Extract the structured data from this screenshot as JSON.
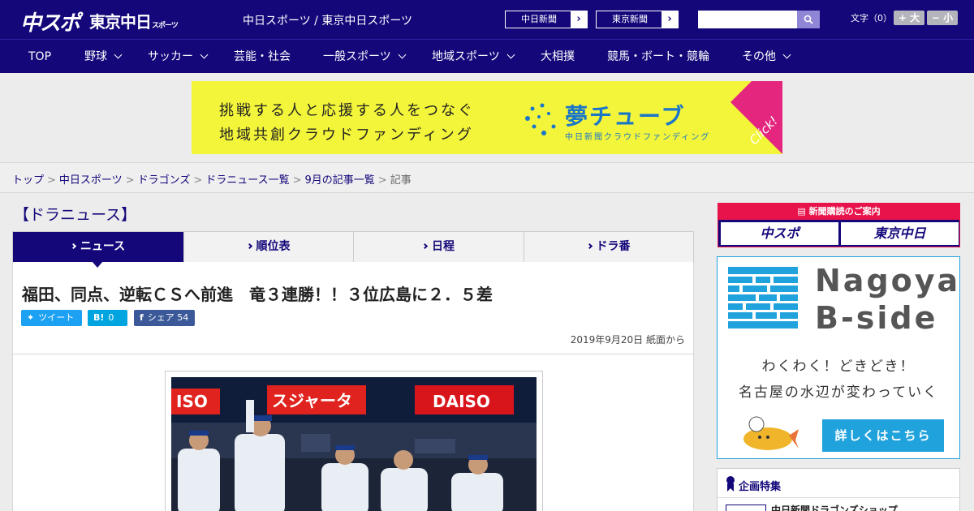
{
  "header": {
    "logo_main": "中スポ",
    "logo_tokyo": "東京中日",
    "logo_tokyo_small": "スポーツ",
    "site_title": "中日スポーツ / 東京中日スポーツ",
    "links": [
      "中日新聞",
      "東京新聞"
    ],
    "search_placeholder": "",
    "font_label": "文字（0）",
    "font_larger": "+ 大",
    "font_smaller": "− 小"
  },
  "nav": {
    "items": [
      {
        "label": "TOP",
        "dropdown": false
      },
      {
        "label": "野球",
        "dropdown": true
      },
      {
        "label": "サッカー",
        "dropdown": true
      },
      {
        "label": "芸能・社会",
        "dropdown": false
      },
      {
        "label": "一般スポーツ",
        "dropdown": true
      },
      {
        "label": "地域スポーツ",
        "dropdown": true
      },
      {
        "label": "大相撲",
        "dropdown": false
      },
      {
        "label": "競馬・ボート・競輪",
        "dropdown": false
      },
      {
        "label": "その他",
        "dropdown": true
      }
    ]
  },
  "banner": {
    "line1": "挑戦する人と応援する人をつなぐ",
    "line2": "地域共創クラウドファンディング",
    "brand": "夢チューブ",
    "brand_sub": "中日新聞クラウドファンディング",
    "click": "Click!"
  },
  "breadcrumb": {
    "links": [
      "トップ",
      "中日スポーツ",
      "ドラゴンズ",
      "ドラニュース一覧",
      "9月の記事一覧"
    ],
    "current": "記事"
  },
  "main": {
    "section_title": "【ドラニュース】",
    "tabs": [
      {
        "label": "ニュース",
        "active": true
      },
      {
        "label": "順位表",
        "active": false
      },
      {
        "label": "日程",
        "active": false
      },
      {
        "label": "ドラ番",
        "active": false
      }
    ],
    "headline": "福田、同点、逆転ＣＳへ前進　竜３連勝！！３位広島に２．５差",
    "share": {
      "tweet": "ツイート",
      "hatena": "0",
      "facebook": "シェア 54"
    },
    "date": "2019年9月20日 紙面から",
    "photo_signs": [
      "ISO",
      "スジャータ",
      "DAISO"
    ]
  },
  "sidebar": {
    "subscribe_title": "新聞購読のご案内",
    "subscribe_buttons": [
      "中スポ",
      "東京中日"
    ],
    "ad": {
      "title_line1": "Nagoya",
      "title_line2": "B-side",
      "text1": "わくわく！どきどき！",
      "text2": "名古屋の水辺が変わっていく",
      "cta": "詳しくはこちら"
    },
    "feature": {
      "title": "企画特集",
      "item": "中日新聞ドラゴンズショップ"
    }
  },
  "colors": {
    "brand_navy": "#13077a",
    "banner_yellow": "#f3f53a",
    "accent_pink": "#e4267f",
    "ad_blue": "#20a2dc",
    "subscribe_red": "#e8134b"
  }
}
